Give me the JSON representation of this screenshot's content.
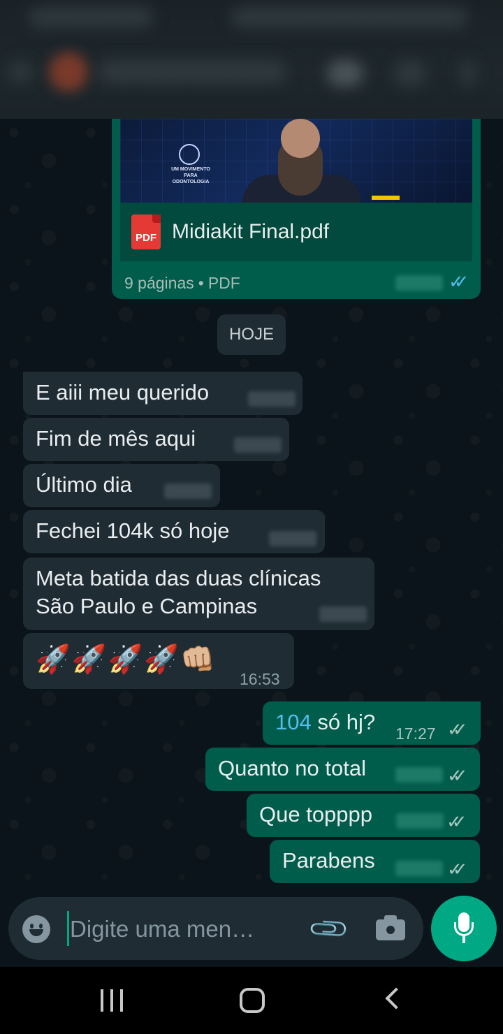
{
  "document": {
    "thumbnail_text": "UM MOVIMENTO PARA ODONTOLOGIA",
    "badge": "PDF",
    "filename": "Midiakit Final.pdf",
    "pages": "9 páginas",
    "separator": "•",
    "type": "PDF"
  },
  "date_chip": "HOJE",
  "incoming": [
    {
      "text": "E aiii meu querido"
    },
    {
      "text": "Fim de mês aqui"
    },
    {
      "text": "Último dia"
    },
    {
      "text": "Fechei 104k só hoje"
    },
    {
      "line1": "Meta batida das duas clínicas",
      "line2": "São Paulo e Campinas"
    },
    {
      "text": "🚀🚀🚀🚀👊🏼",
      "time": "16:53"
    }
  ],
  "outgoing": [
    {
      "highlight": "104",
      "text": " só hj?",
      "time": "17:27",
      "ticks": "✓✓"
    },
    {
      "text": "Quanto no total",
      "ticks": "✓✓"
    },
    {
      "text": "Que topppp",
      "ticks": "✓✓"
    },
    {
      "text": "Parabens",
      "ticks": "✓✓"
    }
  ],
  "composer": {
    "placeholder": "Digite uma men…"
  },
  "icons": {
    "attach": "📎",
    "emoji": "emoji-icon",
    "camera": "camera-icon",
    "mic": "mic-icon"
  },
  "colors": {
    "background": "#0b141a",
    "incoming_bubble": "#1f2c34",
    "outgoing_bubble": "#005c4b",
    "accent": "#00a884",
    "read_ticks": "#53bdeb"
  }
}
